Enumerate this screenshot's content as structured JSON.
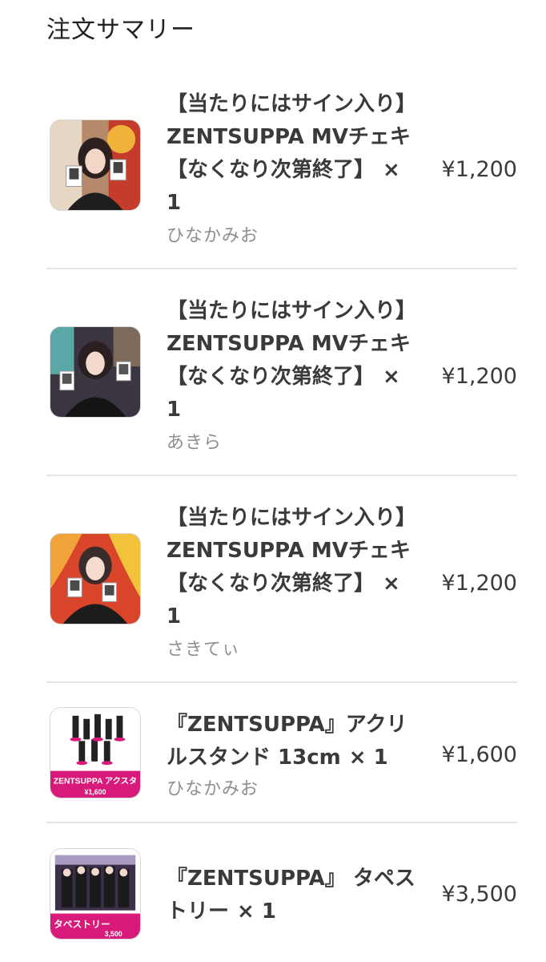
{
  "header": {
    "title": "注文サマリー"
  },
  "items": [
    {
      "name": "【当たりにはサイン入り】ZENTSUPPA MVチェキ【なくなり次第終了】",
      "quantity": "× 1",
      "seller": "ひなかみお",
      "price": "¥1,200",
      "thumbnail": "member-cheki-photo"
    },
    {
      "name": "【当たりにはサイン入り】ZENTSUPPA MVチェキ【なくなり次第終了】",
      "quantity": "× 1",
      "seller": "あきら",
      "price": "¥1,200",
      "thumbnail": "member-cheki-photo"
    },
    {
      "name": "【当たりにはサイン入り】ZENTSUPPA MVチェキ【なくなり次第終了】",
      "quantity": "× 1",
      "seller": "さきてぃ",
      "price": "¥1,200",
      "thumbnail": "member-cheki-photo"
    },
    {
      "name": "『ZENTSUPPA』アクリルスタンド 13cm",
      "quantity": "× 1",
      "seller": "ひなかみお",
      "price": "¥1,600",
      "thumbnail": "acrylic-stand-promo",
      "thumbnail_text": {
        "banner": "ZENTSUPPA アクスタ",
        "price": "¥1,600"
      }
    },
    {
      "name": "『ZENTSUPPA』 タペストリー",
      "quantity": "× 1",
      "seller": "",
      "price": "¥3,500",
      "thumbnail": "tapestry-promo",
      "thumbnail_text": {
        "banner": "タペストリー",
        "price": "3,500"
      }
    }
  ],
  "colors": {
    "accent_pink": "#d81b7a",
    "divider": "#e4e4e4"
  }
}
